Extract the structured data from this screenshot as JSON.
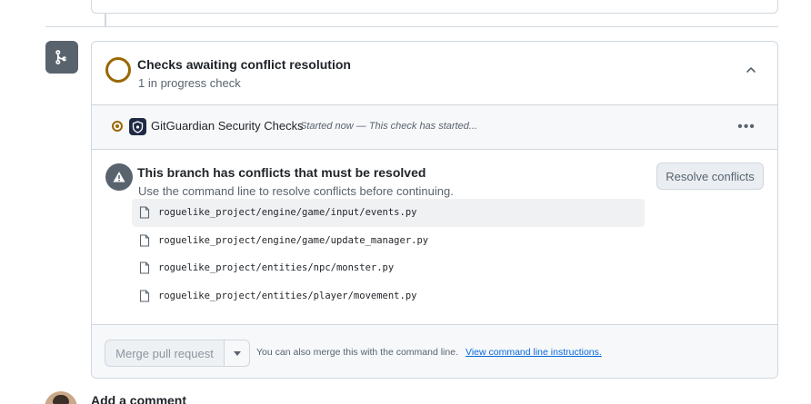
{
  "checks_header": {
    "title": "Checks awaiting conflict resolution",
    "subtitle": "1 in progress check",
    "status_color": "#9a6700"
  },
  "check": {
    "name": "GitGuardian Security Checks",
    "status": "Started now — This check has started...",
    "more_label": "•••"
  },
  "conflicts": {
    "title": "This branch has conflicts that must be resolved",
    "description": "Use the command line to resolve conflicts before continuing.",
    "resolve_label": "Resolve conflicts",
    "files": [
      "roguelike_project/engine/game/input/events.py",
      "roguelike_project/engine/game/update_manager.py",
      "roguelike_project/entities/npc/monster.py",
      "roguelike_project/entities/player/movement.py"
    ]
  },
  "merge": {
    "button_label": "Merge pull request",
    "note": "You can also merge this with the command line.",
    "link": "View command line instructions."
  },
  "comment": {
    "title": "Add a comment"
  }
}
